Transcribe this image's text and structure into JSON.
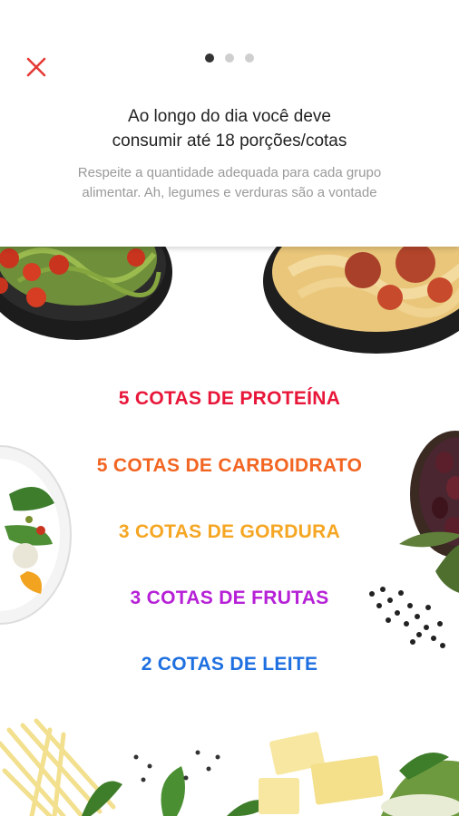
{
  "header": {
    "title_line1": "Ao longo do dia você deve",
    "title_line2": "consumir até 18 porções/cotas",
    "subtitle_line1": "Respeite a quantidade adequada para cada grupo",
    "subtitle_line2": "alimentar. Ah, legumes e verduras são a vontade",
    "close_icon": "close-icon",
    "close_color": "#e53935",
    "pagination": {
      "total": 3,
      "current": 1
    }
  },
  "portions": [
    {
      "label": "5 COTAS DE PROTEÍNA",
      "color": "#e8173a"
    },
    {
      "label": "5 COTAS DE CARBOIDRATO",
      "color": "#f26522"
    },
    {
      "label": "3 COTAS DE GORDURA",
      "color": "#f5a623"
    },
    {
      "label": "3 COTAS DE FRUTAS",
      "color": "#b620d6"
    },
    {
      "label": "2 COTAS DE LEITE",
      "color": "#1e6fe0"
    }
  ]
}
